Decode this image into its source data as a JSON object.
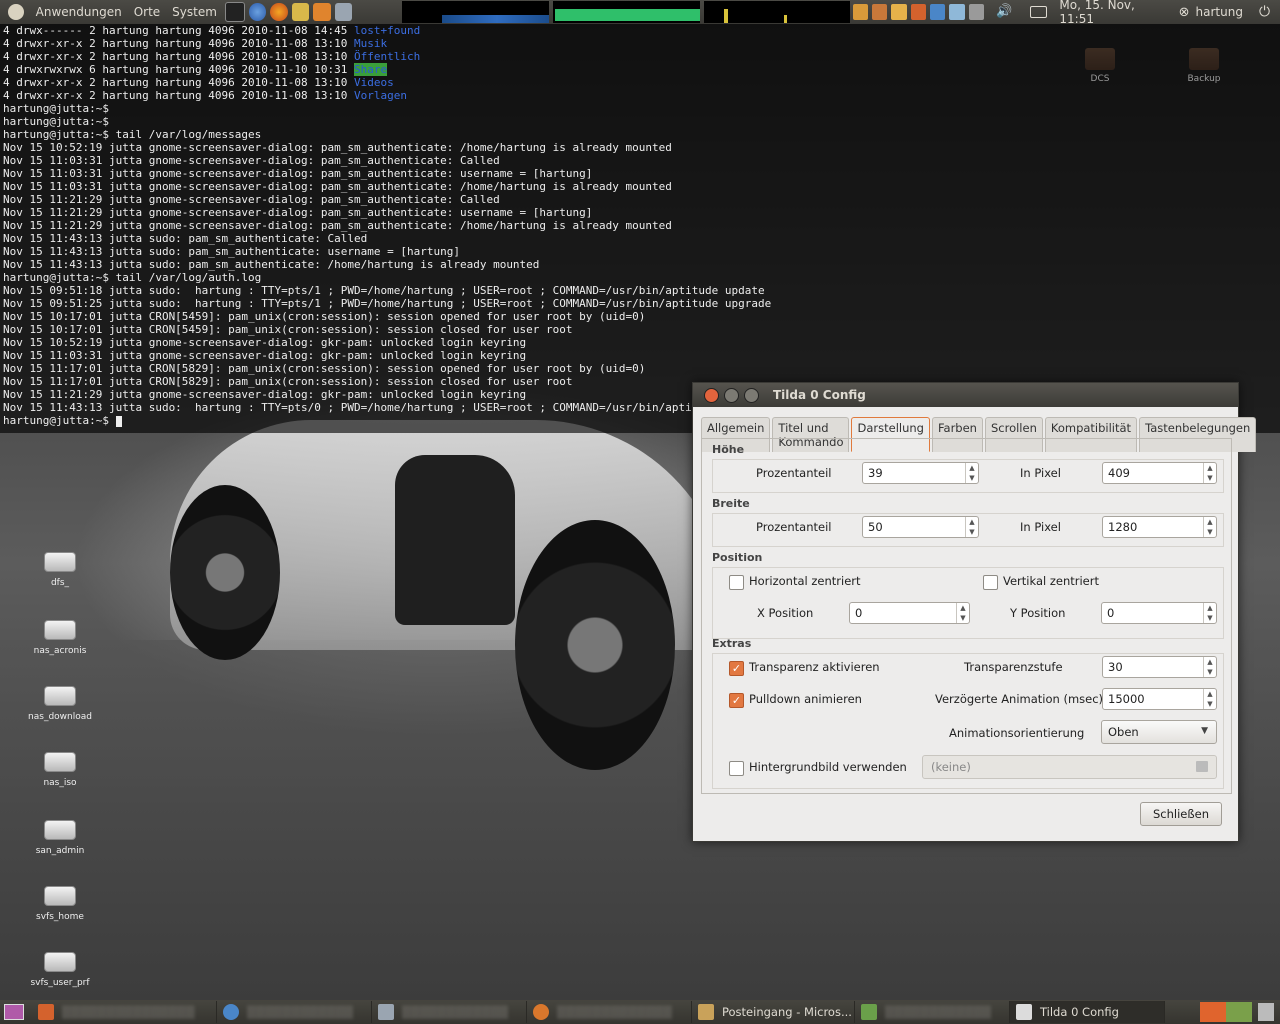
{
  "top_panel": {
    "menus": [
      "Anwendungen",
      "Orte",
      "System"
    ],
    "clock": "Mo, 15. Nov, 11:51",
    "user": "hartung"
  },
  "terminal": {
    "lines": [
      {
        "pre": "4 drwx------ 2 hartung hartung 4096 2010-11-08 14:45 ",
        "name": "lost+found",
        "cls": "dir"
      },
      {
        "pre": "4 drwxr-xr-x 2 hartung hartung 4096 2010-11-08 13:10 ",
        "name": "Musik",
        "cls": "dir"
      },
      {
        "pre": "4 drwxr-xr-x 2 hartung hartung 4096 2010-11-08 13:10 ",
        "name": "Öffentlich",
        "cls": "dir"
      },
      {
        "pre": "4 drwxrwxrwx 6 hartung hartung 4096 2010-11-10 10:31 ",
        "name": "Share",
        "cls": "dir-hl"
      },
      {
        "pre": "4 drwxr-xr-x 2 hartung hartung 4096 2010-11-08 13:10 ",
        "name": "Videos",
        "cls": "dir"
      },
      {
        "pre": "4 drwxr-xr-x 2 hartung hartung 4096 2010-11-08 13:10 ",
        "name": "Vorlagen",
        "cls": "dir"
      },
      {
        "pre": "hartung@jutta:~$",
        "name": "",
        "cls": ""
      },
      {
        "pre": "hartung@jutta:~$",
        "name": "",
        "cls": ""
      },
      {
        "pre": "hartung@jutta:~$ tail /var/log/messages",
        "name": "",
        "cls": ""
      },
      {
        "pre": "Nov 15 10:52:19 jutta gnome-screensaver-dialog: pam_sm_authenticate: /home/hartung is already mounted",
        "name": "",
        "cls": ""
      },
      {
        "pre": "Nov 15 11:03:31 jutta gnome-screensaver-dialog: pam_sm_authenticate: Called",
        "name": "",
        "cls": ""
      },
      {
        "pre": "Nov 15 11:03:31 jutta gnome-screensaver-dialog: pam_sm_authenticate: username = [hartung]",
        "name": "",
        "cls": ""
      },
      {
        "pre": "Nov 15 11:03:31 jutta gnome-screensaver-dialog: pam_sm_authenticate: /home/hartung is already mounted",
        "name": "",
        "cls": ""
      },
      {
        "pre": "Nov 15 11:21:29 jutta gnome-screensaver-dialog: pam_sm_authenticate: Called",
        "name": "",
        "cls": ""
      },
      {
        "pre": "Nov 15 11:21:29 jutta gnome-screensaver-dialog: pam_sm_authenticate: username = [hartung]",
        "name": "",
        "cls": ""
      },
      {
        "pre": "Nov 15 11:21:29 jutta gnome-screensaver-dialog: pam_sm_authenticate: /home/hartung is already mounted",
        "name": "",
        "cls": ""
      },
      {
        "pre": "Nov 15 11:43:13 jutta sudo: pam_sm_authenticate: Called",
        "name": "",
        "cls": ""
      },
      {
        "pre": "Nov 15 11:43:13 jutta sudo: pam_sm_authenticate: username = [hartung]",
        "name": "",
        "cls": ""
      },
      {
        "pre": "Nov 15 11:43:13 jutta sudo: pam_sm_authenticate: /home/hartung is already mounted",
        "name": "",
        "cls": ""
      },
      {
        "pre": "hartung@jutta:~$ tail /var/log/auth.log",
        "name": "",
        "cls": ""
      },
      {
        "pre": "Nov 15 09:51:18 jutta sudo:  hartung : TTY=pts/1 ; PWD=/home/hartung ; USER=root ; COMMAND=/usr/bin/aptitude update",
        "name": "",
        "cls": ""
      },
      {
        "pre": "Nov 15 09:51:25 jutta sudo:  hartung : TTY=pts/1 ; PWD=/home/hartung ; USER=root ; COMMAND=/usr/bin/aptitude upgrade",
        "name": "",
        "cls": ""
      },
      {
        "pre": "Nov 15 10:17:01 jutta CRON[5459]: pam_unix(cron:session): session opened for user root by (uid=0)",
        "name": "",
        "cls": ""
      },
      {
        "pre": "Nov 15 10:17:01 jutta CRON[5459]: pam_unix(cron:session): session closed for user root",
        "name": "",
        "cls": ""
      },
      {
        "pre": "Nov 15 10:52:19 jutta gnome-screensaver-dialog: gkr-pam: unlocked login keyring",
        "name": "",
        "cls": ""
      },
      {
        "pre": "Nov 15 11:03:31 jutta gnome-screensaver-dialog: gkr-pam: unlocked login keyring",
        "name": "",
        "cls": ""
      },
      {
        "pre": "Nov 15 11:17:01 jutta CRON[5829]: pam_unix(cron:session): session opened for user root by (uid=0)",
        "name": "",
        "cls": ""
      },
      {
        "pre": "Nov 15 11:17:01 jutta CRON[5829]: pam_unix(cron:session): session closed for user root",
        "name": "",
        "cls": ""
      },
      {
        "pre": "Nov 15 11:21:29 jutta gnome-screensaver-dialog: gkr-pam: unlocked login keyring",
        "name": "",
        "cls": ""
      },
      {
        "pre": "Nov 15 11:43:13 jutta sudo:  hartung : TTY=pts/0 ; PWD=/home/hartung ; USER=root ; COMMAND=/usr/bin/aptitude instal",
        "name": "",
        "cls": ""
      },
      {
        "pre": "hartung@jutta:~$ ",
        "name": "",
        "cls": "",
        "cursor": true
      }
    ]
  },
  "desktop_icons": {
    "left": [
      "dfs_",
      "nas_acronis",
      "nas_download",
      "nas_iso",
      "san_admin",
      "svfs_home",
      "svfs_user_prf"
    ],
    "right": [
      "DCS",
      "Backup"
    ]
  },
  "dialog": {
    "title": "Tilda 0 Config",
    "tabs": [
      "Allgemein",
      "Titel und Kommando",
      "Darstellung",
      "Farben",
      "Scrollen",
      "Kompatibilität",
      "Tastenbelegungen"
    ],
    "active_tab": "Darstellung",
    "hoehe": {
      "section": "Höhe",
      "pct_label": "Prozentanteil",
      "pct_value": "39",
      "px_label": "In Pixel",
      "px_value": "409"
    },
    "breite": {
      "section": "Breite",
      "pct_label": "Prozentanteil",
      "pct_value": "50",
      "px_label": "In Pixel",
      "px_value": "1280"
    },
    "position": {
      "section": "Position",
      "h_center": "Horizontal zentriert",
      "v_center": "Vertikal zentriert",
      "x_label": "X Position",
      "x_value": "0",
      "y_label": "Y Position",
      "y_value": "0"
    },
    "extras": {
      "section": "Extras",
      "transparency": "Transparenz aktivieren",
      "transparency_level_label": "Transparenzstufe",
      "transparency_level": "30",
      "pulldown": "Pulldown animieren",
      "delay_label": "Verzögerte Animation (msec)",
      "delay_value": "15000",
      "orientation_label": "Animationsorientierung",
      "orientation_value": "Oben",
      "bgimage": "Hintergrundbild verwenden",
      "bgimage_value": "(keine)"
    },
    "close_button": "Schließen"
  },
  "taskbar": {
    "tasks": [
      {
        "label": "Posteingang - Micros...",
        "prefix": "[",
        "blur": false
      },
      {
        "label": "Tilda 0 Config",
        "prefix": "",
        "blur": false,
        "active": true
      }
    ]
  }
}
